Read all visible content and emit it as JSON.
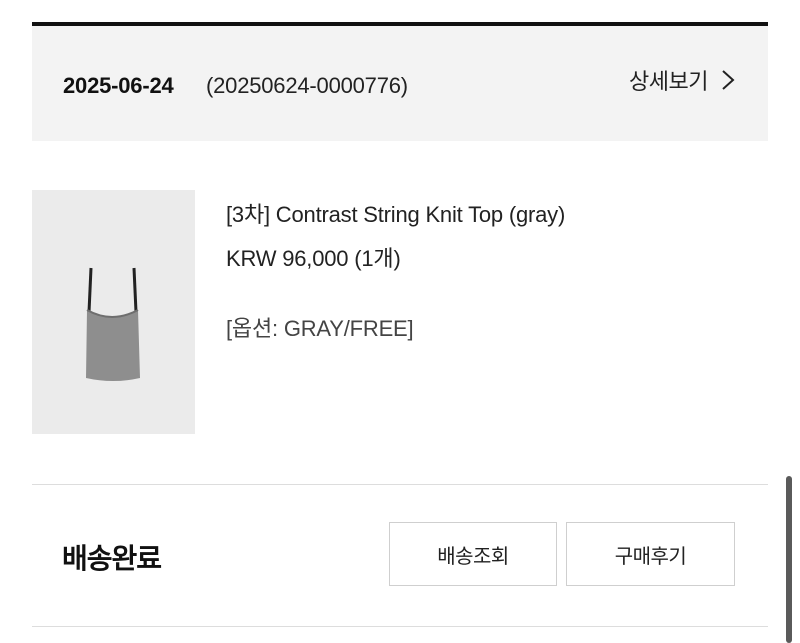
{
  "order": {
    "date": "2025-06-24",
    "number": "(20250624-0000776)",
    "detail_label": "상세보기",
    "detail_icon": "chevron-right-icon"
  },
  "product": {
    "name": "[3차] Contrast String Knit Top (gray)",
    "price": "KRW 96,000 (1개)",
    "option": "[옵션: GRAY/FREE]",
    "image_icon": "knit-top-image"
  },
  "delivery": {
    "status": "배송완료",
    "track_button": "배송조회",
    "review_button": "구매후기"
  },
  "colors": {
    "header_bg": "#f3f3f3",
    "top_rule": "#111111",
    "divider": "#dddddd",
    "button_border": "#cfcfcf",
    "thumb_bg": "#ebebeb"
  }
}
